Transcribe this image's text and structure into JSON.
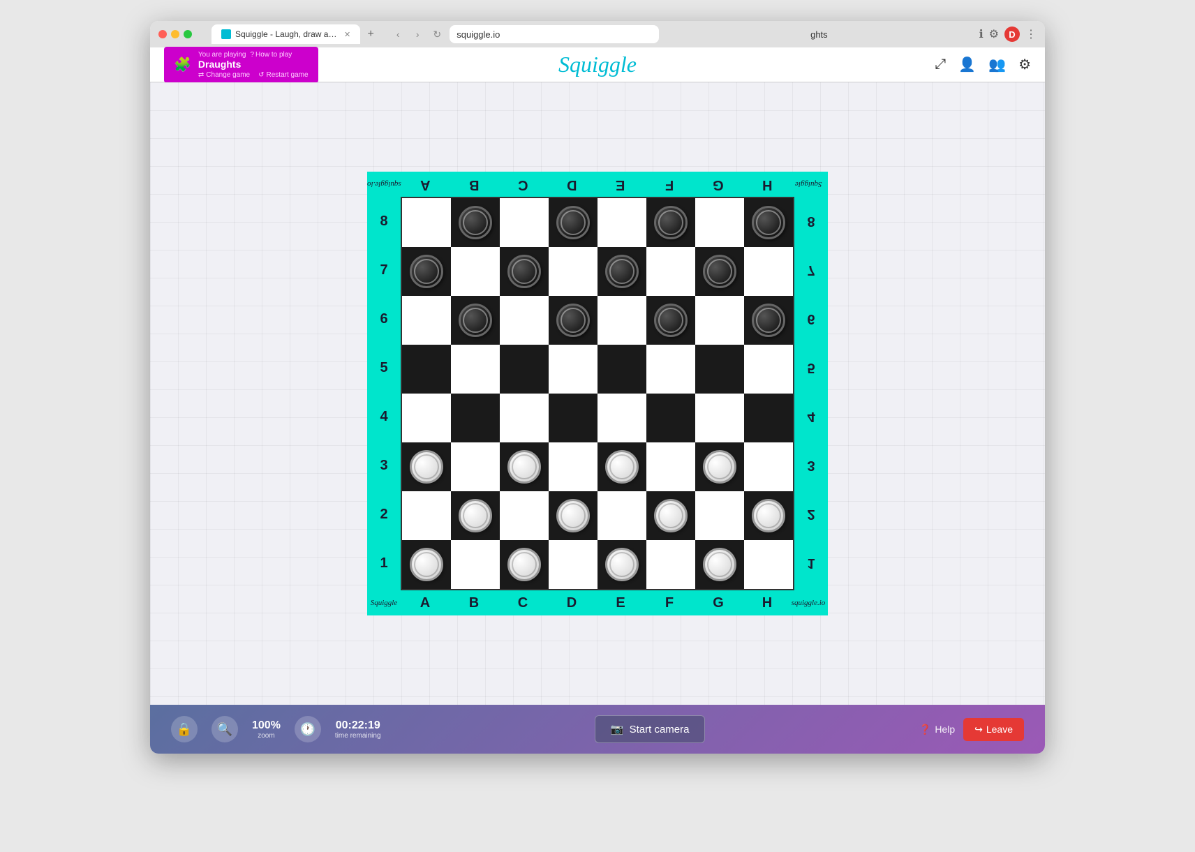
{
  "browser": {
    "tab_title": "Squiggle - Laugh, draw and pl...",
    "url": "squiggle.io",
    "omnibox_text": "ghts",
    "new_tab_label": "+"
  },
  "header": {
    "playing_label": "You are playing",
    "how_to_play": "How to play",
    "game_name": "Draughts",
    "change_game": "Change game",
    "restart_game": "Restart game",
    "site_title": "Squiggle"
  },
  "board": {
    "cols_top_mirrored": [
      "A",
      "B",
      "C",
      "D",
      "E",
      "F",
      "G",
      "H"
    ],
    "cols_bottom": [
      "A",
      "B",
      "C",
      "D",
      "E",
      "F",
      "G",
      "H"
    ],
    "rows_left": [
      "8",
      "7",
      "6",
      "5",
      "4",
      "3",
      "2",
      "1"
    ],
    "rows_right_mirrored": [
      "8",
      "7",
      "6",
      "5",
      "4",
      "3",
      "2",
      "1"
    ],
    "squiggle_left": "squiggle.io",
    "squiggle_right": "Squiggle",
    "squiggle_bottom_left": "Squiggle",
    "squiggle_bottom_right": "squiggle.io"
  },
  "bottom_bar": {
    "zoom_value": "100%",
    "zoom_label": "zoom",
    "time_value": "00:22:19",
    "time_label": "time remaining",
    "start_camera_label": "Start camera",
    "help_label": "Help",
    "leave_label": "Leave"
  },
  "icons": {
    "lock": "🔒",
    "search": "🔍",
    "clock": "🕐",
    "camera": "📷",
    "help_circle": "❓",
    "leave_arrow": "↪",
    "shrink": "⤢",
    "add_person": "👤",
    "group": "👥",
    "settings": "⚙",
    "puzzle": "🧩",
    "refresh": "↺",
    "change": "⇄"
  }
}
